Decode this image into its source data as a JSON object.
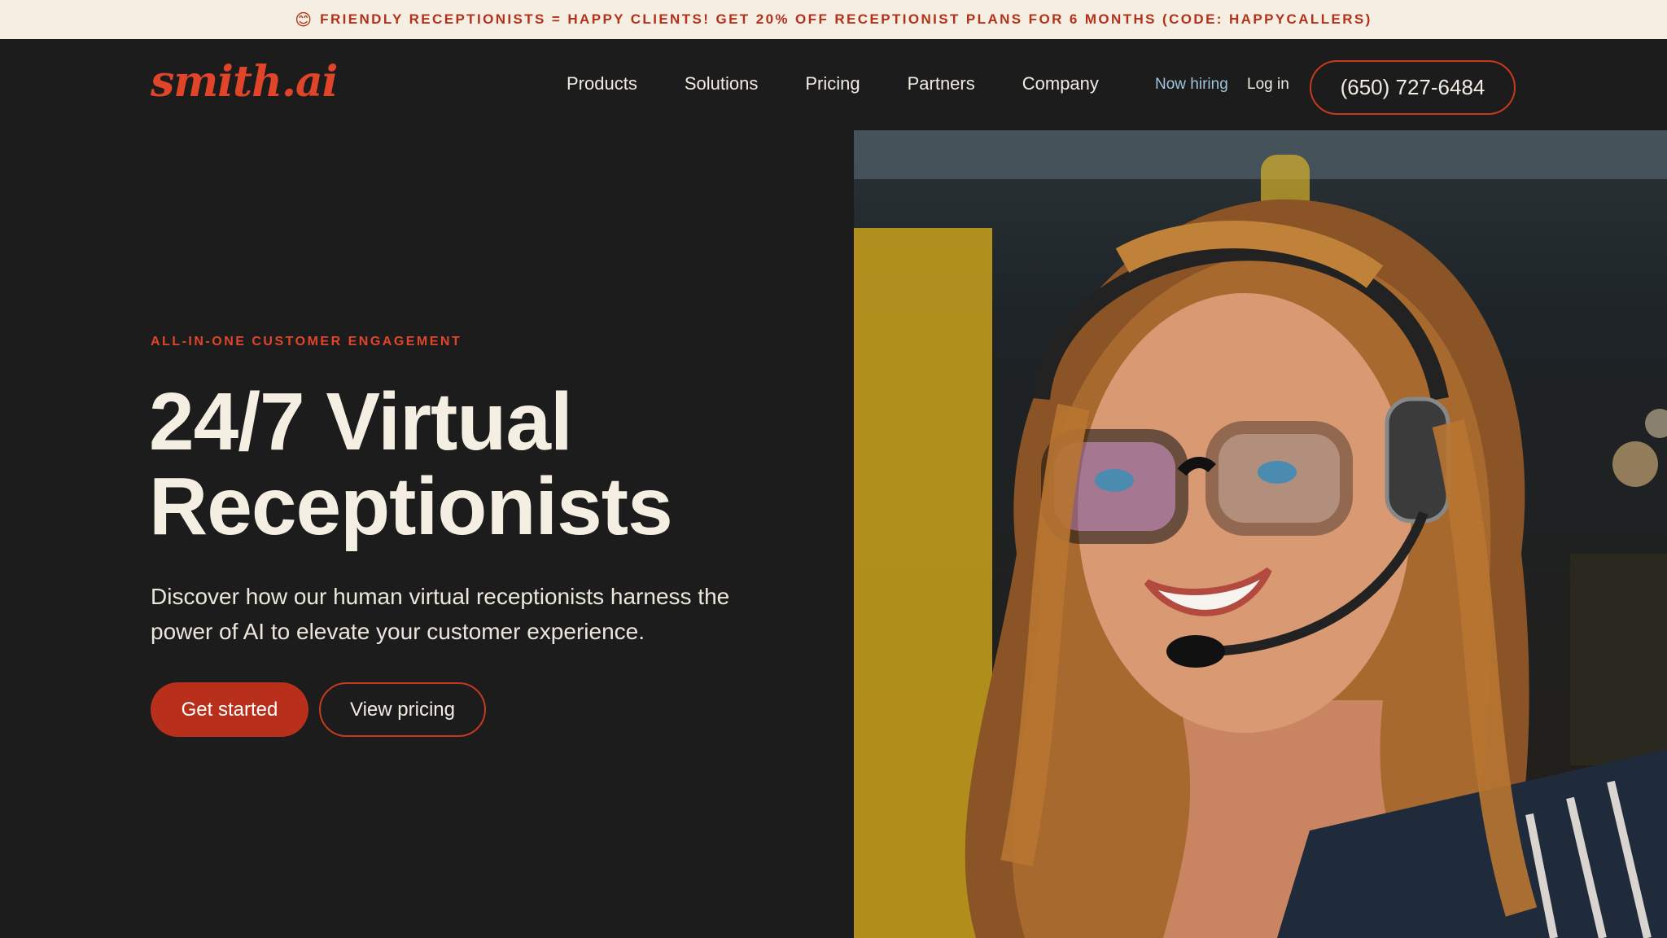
{
  "promo": {
    "emoji": "😊",
    "text": "FRIENDLY RECEPTIONISTS = HAPPY CLIENTS! GET 20% OFF RECEPTIONIST PLANS FOR 6 MONTHS (CODE: HAPPYCALLERS)"
  },
  "header": {
    "logo": "smith.ai",
    "nav": [
      "Products",
      "Solutions",
      "Pricing",
      "Partners",
      "Company"
    ],
    "now_hiring": "Now hiring",
    "login": "Log in",
    "phone": "(650) 727-6484"
  },
  "hero": {
    "eyebrow": "ALL-IN-ONE CUSTOMER ENGAGEMENT",
    "headline_line1": "24/7 Virtual",
    "headline_line2": "Receptionists",
    "subtext": "Discover how our human virtual receptionists harness the power of AI to elevate your customer experience.",
    "primary_cta": "Get started",
    "secondary_cta": "View pricing"
  },
  "colors": {
    "accent": "#e0452a",
    "button_red": "#b8301b",
    "background": "#1c1c1c",
    "banner": "#f4efe2",
    "link_blue": "#9fc4dc"
  }
}
